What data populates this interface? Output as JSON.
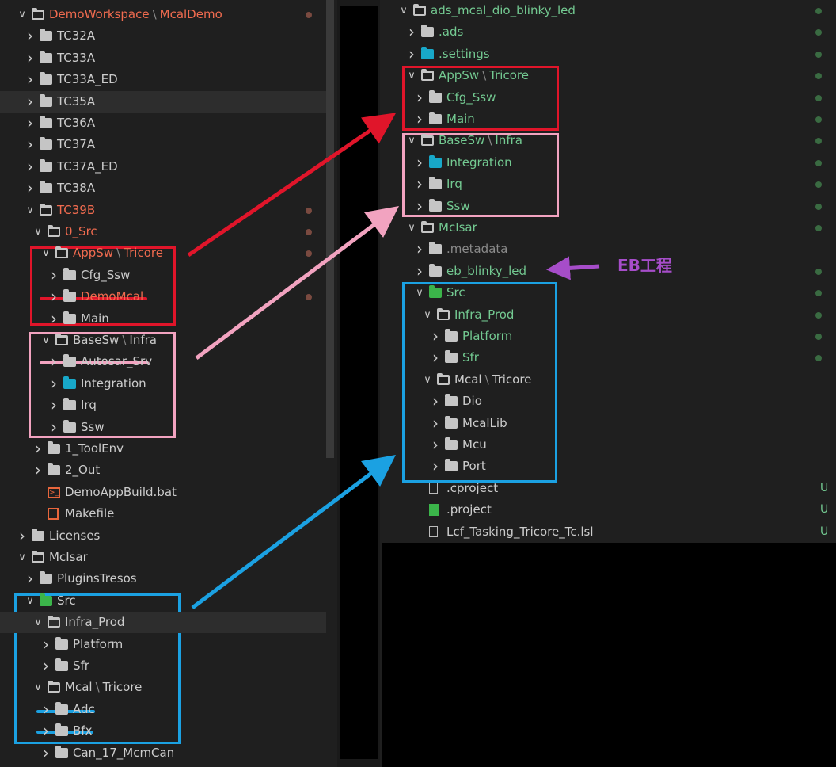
{
  "left_tree": [
    {
      "depth": 1,
      "chev": "v",
      "icon": "folder-open",
      "label": "DemoWorkspace",
      "label2": "McalDemo",
      "color": "red",
      "dot": true
    },
    {
      "depth": 2,
      "chev": ">",
      "icon": "folder",
      "label": "TC32A"
    },
    {
      "depth": 2,
      "chev": ">",
      "icon": "folder",
      "label": "TC33A"
    },
    {
      "depth": 2,
      "chev": ">",
      "icon": "folder",
      "label": "TC33A_ED"
    },
    {
      "depth": 2,
      "chev": ">",
      "icon": "folder",
      "label": "TC35A",
      "selected": true
    },
    {
      "depth": 2,
      "chev": ">",
      "icon": "folder",
      "label": "TC36A"
    },
    {
      "depth": 2,
      "chev": ">",
      "icon": "folder",
      "label": "TC37A"
    },
    {
      "depth": 2,
      "chev": ">",
      "icon": "folder",
      "label": "TC37A_ED"
    },
    {
      "depth": 2,
      "chev": ">",
      "icon": "folder",
      "label": "TC38A"
    },
    {
      "depth": 2,
      "chev": "v",
      "icon": "folder-open",
      "label": "TC39B",
      "color": "red",
      "dot": true
    },
    {
      "depth": 3,
      "chev": "v",
      "icon": "folder-open",
      "label": "0_Src",
      "color": "red",
      "dot": true
    },
    {
      "depth": 4,
      "chev": "v",
      "icon": "folder-open",
      "label": "AppSw",
      "label2": "Tricore",
      "color": "red",
      "dot": true
    },
    {
      "depth": 5,
      "chev": ">",
      "icon": "folder",
      "label": "Cfg_Ssw"
    },
    {
      "depth": 5,
      "chev": ">",
      "icon": "folder",
      "label": "DemoMcal",
      "color": "red",
      "dot": true
    },
    {
      "depth": 5,
      "chev": ">",
      "icon": "folder",
      "label": "Main"
    },
    {
      "depth": 4,
      "chev": "v",
      "icon": "folder-open",
      "label": "BaseSw",
      "label2": "Infra"
    },
    {
      "depth": 5,
      "chev": ">",
      "icon": "folder",
      "label": "Autosar_Srv"
    },
    {
      "depth": 5,
      "chev": ">",
      "icon": "folder-cyan",
      "label": "Integration"
    },
    {
      "depth": 5,
      "chev": ">",
      "icon": "folder",
      "label": "Irq"
    },
    {
      "depth": 5,
      "chev": ">",
      "icon": "folder",
      "label": "Ssw"
    },
    {
      "depth": 3,
      "chev": ">",
      "icon": "folder",
      "label": "1_ToolEnv"
    },
    {
      "depth": 3,
      "chev": ">",
      "icon": "folder",
      "label": "2_Out"
    },
    {
      "depth": 3,
      "chev": "",
      "icon": "bat",
      "label": "DemoAppBuild.bat"
    },
    {
      "depth": 3,
      "chev": "",
      "icon": "makefile",
      "label": "Makefile"
    },
    {
      "depth": 1,
      "chev": ">",
      "icon": "folder",
      "label": "Licenses"
    },
    {
      "depth": 1,
      "chev": "v",
      "icon": "folder-open",
      "label": "McIsar"
    },
    {
      "depth": 2,
      "chev": ">",
      "icon": "folder",
      "label": "PluginsTresos"
    },
    {
      "depth": 2,
      "chev": "v",
      "icon": "folder-green",
      "label": "Src"
    },
    {
      "depth": 3,
      "chev": "v",
      "icon": "folder-open",
      "label": "Infra_Prod",
      "selected": true
    },
    {
      "depth": 4,
      "chev": ">",
      "icon": "folder",
      "label": "Platform"
    },
    {
      "depth": 4,
      "chev": ">",
      "icon": "folder",
      "label": "Sfr"
    },
    {
      "depth": 3,
      "chev": "v",
      "icon": "folder-open",
      "label": "Mcal",
      "label2": "Tricore"
    },
    {
      "depth": 4,
      "chev": ">",
      "icon": "folder",
      "label": "Adc"
    },
    {
      "depth": 4,
      "chev": ">",
      "icon": "folder",
      "label": "Bfx"
    },
    {
      "depth": 4,
      "chev": ">",
      "icon": "folder",
      "label": "Can_17_McmCan"
    }
  ],
  "right_tree": [
    {
      "depth": 1,
      "chev": "v",
      "icon": "folder-open",
      "label": "ads_mcal_dio_blinky_led",
      "color": "green",
      "dot": true
    },
    {
      "depth": 2,
      "chev": ">",
      "icon": "folder",
      "label": ".ads",
      "color": "green",
      "dot": true
    },
    {
      "depth": 2,
      "chev": ">",
      "icon": "folder-cyan",
      "label": ".settings",
      "color": "green",
      "dot": true
    },
    {
      "depth": 2,
      "chev": "v",
      "icon": "folder-open",
      "label": "AppSw",
      "label2": "Tricore",
      "color": "green",
      "dot": true
    },
    {
      "depth": 3,
      "chev": ">",
      "icon": "folder",
      "label": "Cfg_Ssw",
      "color": "green",
      "dot": true
    },
    {
      "depth": 3,
      "chev": ">",
      "icon": "folder",
      "label": "Main",
      "color": "green",
      "dot": true
    },
    {
      "depth": 2,
      "chev": "v",
      "icon": "folder-open",
      "label": "BaseSw",
      "label2": "Infra",
      "color": "green",
      "dot": true
    },
    {
      "depth": 3,
      "chev": ">",
      "icon": "folder-cyan",
      "label": "Integration",
      "color": "green",
      "dot": true
    },
    {
      "depth": 3,
      "chev": ">",
      "icon": "folder",
      "label": "Irq",
      "color": "green",
      "dot": true
    },
    {
      "depth": 3,
      "chev": ">",
      "icon": "folder",
      "label": "Ssw",
      "color": "green",
      "dot": true
    },
    {
      "depth": 2,
      "chev": "v",
      "icon": "folder-open",
      "label": "McIsar",
      "color": "green",
      "dot": true
    },
    {
      "depth": 3,
      "chev": ">",
      "icon": "folder",
      "label": ".metadata",
      "color": "dim"
    },
    {
      "depth": 3,
      "chev": ">",
      "icon": "folder",
      "label": "eb_blinky_led",
      "color": "green",
      "dot": true
    },
    {
      "depth": 3,
      "chev": "v",
      "icon": "folder-green",
      "label": "Src",
      "color": "green",
      "dot": true
    },
    {
      "depth": 4,
      "chev": "v",
      "icon": "folder-open",
      "label": "Infra_Prod",
      "color": "green",
      "dot": true
    },
    {
      "depth": 5,
      "chev": ">",
      "icon": "folder",
      "label": "Platform",
      "color": "green",
      "dot": true
    },
    {
      "depth": 5,
      "chev": ">",
      "icon": "folder",
      "label": "Sfr",
      "color": "green",
      "dot": true
    },
    {
      "depth": 4,
      "chev": "v",
      "icon": "folder-open",
      "label": "Mcal",
      "label2": "Tricore"
    },
    {
      "depth": 5,
      "chev": ">",
      "icon": "folder",
      "label": "Dio"
    },
    {
      "depth": 5,
      "chev": ">",
      "icon": "folder",
      "label": "McalLib"
    },
    {
      "depth": 5,
      "chev": ">",
      "icon": "folder",
      "label": "Mcu"
    },
    {
      "depth": 5,
      "chev": ">",
      "icon": "folder",
      "label": "Port"
    },
    {
      "depth": 3,
      "chev": "",
      "icon": "file",
      "label": ".cproject",
      "badge": "U"
    },
    {
      "depth": 3,
      "chev": "",
      "icon": "project",
      "label": ".project",
      "badge": "U"
    },
    {
      "depth": 3,
      "chev": "",
      "icon": "file",
      "label": "Lcf_Tasking_Tricore_Tc.lsl",
      "badge": "U"
    }
  ],
  "annotation": {
    "eb_label": "EB工程"
  },
  "colors": {
    "red_box": "#e0152a",
    "pink_box": "#f2a3c0",
    "blue_box": "#1ba1e2",
    "purple": "#a64dc9"
  }
}
